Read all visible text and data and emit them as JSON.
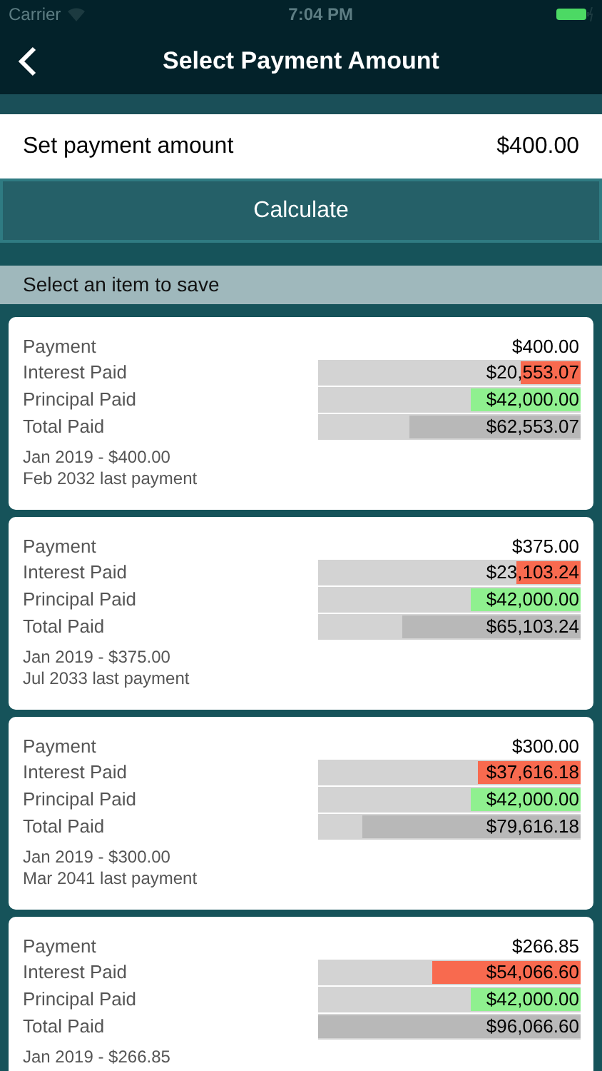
{
  "status_bar": {
    "carrier": "Carrier",
    "time": "7:04 PM"
  },
  "nav": {
    "title": "Select Payment Amount"
  },
  "amount_row": {
    "label": "Set payment amount",
    "value": "$400.00"
  },
  "calculate_button": "Calculate",
  "section_header": "Select an item to save",
  "cards": [
    {
      "payment_label": "Payment",
      "payment": "$400.00",
      "bars": [
        {
          "kind": "interest",
          "label": "Interest Paid",
          "value": "$20,553.07",
          "level": 0.23
        },
        {
          "kind": "principal",
          "label": "Principal Paid",
          "value": "$42,000.00",
          "level": 0.42
        },
        {
          "kind": "total",
          "label": "Total Paid",
          "value": "$62,553.07",
          "level": 0.65
        }
      ],
      "notes": [
        "Jan 2019 - $400.00",
        "Feb 2032 last payment"
      ]
    },
    {
      "payment_label": "Payment",
      "payment": "$375.00",
      "bars": [
        {
          "kind": "interest",
          "label": "Interest Paid",
          "value": "$23,103.24",
          "level": 0.245
        },
        {
          "kind": "principal",
          "label": "Principal Paid",
          "value": "$42,000.00",
          "level": 0.42
        },
        {
          "kind": "total",
          "label": "Total Paid",
          "value": "$65,103.24",
          "level": 0.68
        }
      ],
      "notes": [
        "Jan 2019 - $375.00",
        "Jul 2033 last payment"
      ]
    },
    {
      "payment_label": "Payment",
      "payment": "$300.00",
      "bars": [
        {
          "kind": "interest",
          "label": "Interest Paid",
          "value": "$37,616.18",
          "level": 0.39
        },
        {
          "kind": "principal",
          "label": "Principal Paid",
          "value": "$42,000.00",
          "level": 0.42
        },
        {
          "kind": "total",
          "label": "Total Paid",
          "value": "$79,616.18",
          "level": 0.83
        }
      ],
      "notes": [
        "Jan 2019 - $300.00",
        "Mar 2041 last payment"
      ]
    },
    {
      "payment_label": "Payment",
      "payment": "$266.85",
      "bars": [
        {
          "kind": "interest",
          "label": "Interest Paid",
          "value": "$54,066.60",
          "level": 0.565
        },
        {
          "kind": "principal",
          "label": "Principal Paid",
          "value": "$42,000.00",
          "level": 0.42
        },
        {
          "kind": "total",
          "label": "Total Paid",
          "value": "$96,066.60",
          "level": 1.0
        }
      ],
      "notes": [
        "Jan 2019 - $266.85"
      ]
    }
  ]
}
